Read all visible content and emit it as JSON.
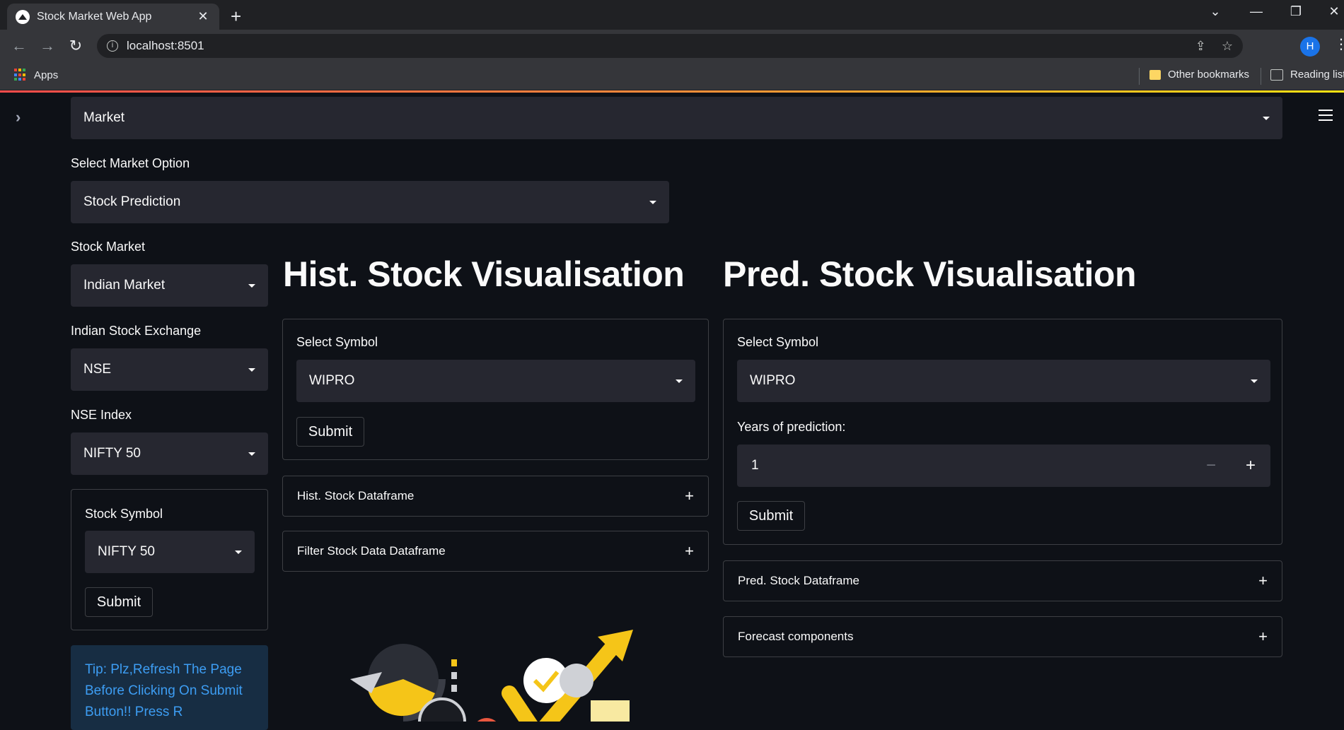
{
  "browser": {
    "tab_title": "Stock Market Web App",
    "url": "localhost:8501",
    "avatar_letter": "H",
    "bookmarks": {
      "apps": "Apps",
      "other": "Other bookmarks",
      "reading": "Reading list"
    }
  },
  "app": {
    "top_select": "Market",
    "market_option": {
      "label": "Select Market Option",
      "value": "Stock Prediction"
    },
    "sidebar": {
      "stock_market": {
        "label": "Stock Market",
        "value": "Indian Market"
      },
      "exchange": {
        "label": "Indian Stock Exchange",
        "value": "NSE"
      },
      "index": {
        "label": "NSE Index",
        "value": "NIFTY 50"
      },
      "symbol_form": {
        "label": "Stock Symbol",
        "value": "NIFTY 50",
        "submit": "Submit"
      },
      "tip": "Tip: Plz,Refresh The Page Before Clicking On Submit Button!! Press R"
    },
    "hist": {
      "title": "Hist. Stock Visualisation",
      "form": {
        "label": "Select Symbol",
        "value": "WIPRO",
        "submit": "Submit"
      },
      "expanders": [
        "Hist. Stock Dataframe",
        "Filter Stock Data Dataframe"
      ]
    },
    "pred": {
      "title": "Pred. Stock Visualisation",
      "form": {
        "label": "Select Symbol",
        "value": "WIPRO",
        "years_label": "Years of prediction:",
        "years_value": "1",
        "minus": "−",
        "plus": "+",
        "submit": "Submit"
      },
      "expanders": [
        "Pred. Stock Dataframe",
        "Forecast components"
      ]
    }
  },
  "colors": {
    "background": "#0e1117",
    "widget": "#262730",
    "tip_bg": "#172d43",
    "tip_text": "#3d9df3",
    "accent_yellow": "#f5c518"
  }
}
